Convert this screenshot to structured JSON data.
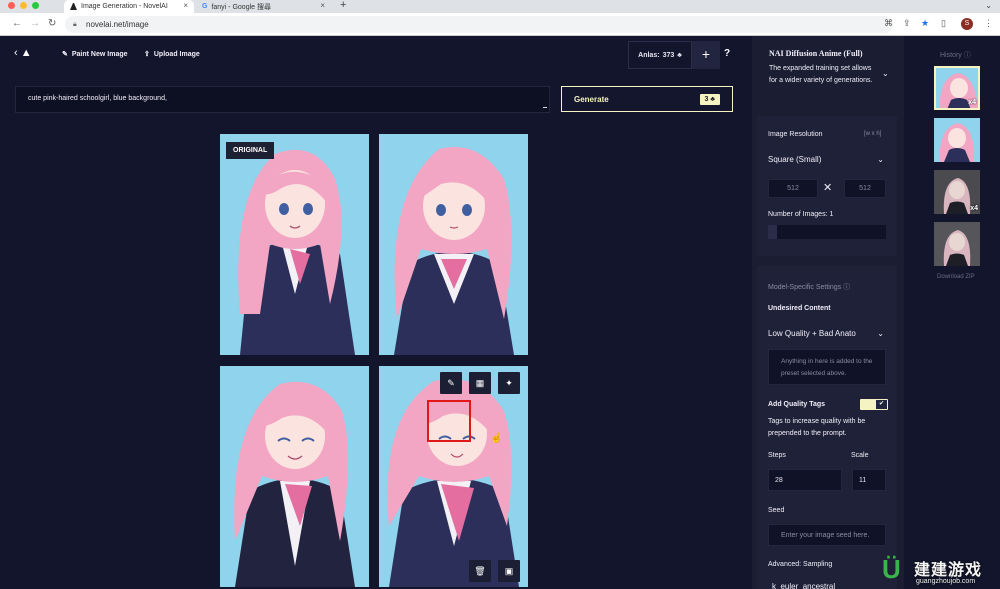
{
  "browser": {
    "tabs": [
      {
        "title": "Image Generation - NovelAI",
        "active": true
      },
      {
        "title": "fanyi - Google 搜尋",
        "active": false
      }
    ],
    "url": "novelai.net/image",
    "profile_initial": "S"
  },
  "topbar": {
    "paint_label": "Paint New Image",
    "upload_label": "Upload Image",
    "anlas_label": "Anlas:",
    "anlas_value": "373",
    "plus_label": "+",
    "help_label": "?"
  },
  "prompt": {
    "text": "cute pink-haired schoolgirl, blue background,"
  },
  "generate": {
    "label": "Generate",
    "cost": "3"
  },
  "images": {
    "original_badge": "ORIGINAL"
  },
  "settings": {
    "model_name": "NAI Diffusion Anime (Full)",
    "model_desc": "The expanded training set allows for a wider variety of generations.",
    "resolution_label": "Image Resolution",
    "resolution_hint": "[w x h]",
    "resolution_value": "Square (Small)",
    "width": "512",
    "height": "512",
    "num_images_label": "Number of Images:",
    "num_images_value": "1",
    "model_specific_label": "Model-Specific Settings",
    "undesired_label": "Undesired Content",
    "undesired_value": "Low Quality + Bad Anato",
    "undesired_placeholder": "Anything in here is added to the preset selected above.",
    "quality_tags_label": "Add Quality Tags",
    "quality_tags_desc": "Tags to increase quality with be prepended to the prompt.",
    "quality_tags_on": true,
    "steps_label": "Steps",
    "steps_value": "28",
    "scale_label": "Scale",
    "scale_value": "11",
    "seed_label": "Seed",
    "seed_placeholder": "Enter your image seed here.",
    "sampling_label": "Advanced: Sampling",
    "sampling_value": "k_euler_ancestral"
  },
  "history": {
    "title": "History",
    "download_label": "Download ZIP",
    "thumbs": [
      {
        "badge": "x4",
        "selected": true
      },
      {
        "badge": "",
        "selected": false
      },
      {
        "badge": "x4",
        "selected": false
      },
      {
        "badge": "",
        "selected": false
      }
    ]
  },
  "watermark": {
    "cn": "建建游戏",
    "url": "guangzhoujob.com"
  },
  "colors": {
    "bg": "#13152c",
    "panel": "#1b1d33",
    "accent": "#f5f3c2",
    "highlight": "#e01818",
    "hair": "#f2a6c4",
    "uniform": "#2c2f5a"
  }
}
